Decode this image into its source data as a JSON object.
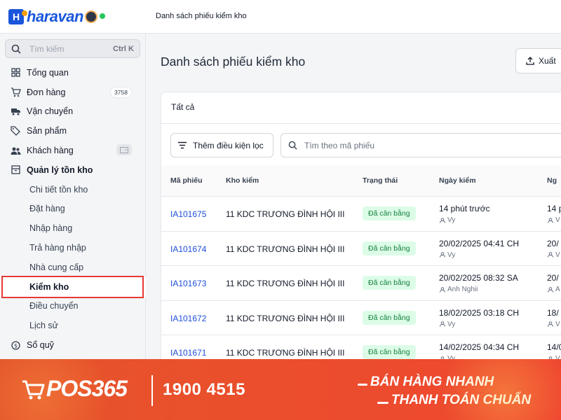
{
  "brand": {
    "logo_text": "haravan"
  },
  "header": {
    "breadcrumb": "Danh sách phiếu kiểm kho"
  },
  "sidebar": {
    "search_placeholder": "Tìm kiếm",
    "search_shortcut": "Ctrl K",
    "items": [
      {
        "label": "Tổng quan",
        "icon": "dashboard-icon"
      },
      {
        "label": "Đơn hàng",
        "icon": "cart-icon",
        "badge": "3758"
      },
      {
        "label": "Vận chuyển",
        "icon": "truck-icon"
      },
      {
        "label": "Sản phẩm",
        "icon": "tag-icon"
      },
      {
        "label": "Khách hàng",
        "icon": "users-icon"
      },
      {
        "label": "Quản lý tồn kho",
        "icon": "inventory-icon"
      }
    ],
    "sub_items": [
      {
        "label": "Chi tiết tồn kho"
      },
      {
        "label": "Đặt hàng"
      },
      {
        "label": "Nhập hàng"
      },
      {
        "label": "Trả hàng nhập"
      },
      {
        "label": "Nhà cung cấp"
      },
      {
        "label": "Kiểm kho",
        "active": true
      },
      {
        "label": "Điều chuyển"
      },
      {
        "label": "Lịch sử"
      }
    ],
    "partial_item": {
      "label": "Sổ quỹ"
    }
  },
  "main": {
    "title": "Danh sách phiếu kiểm kho",
    "export_label": "Xuất",
    "tab_all": "Tất cả",
    "filter_label": "Thêm điều kiện lọc",
    "search_placeholder": "Tìm theo mã phiếu",
    "columns": [
      "Mã phiếu",
      "Kho kiểm",
      "Trạng thái",
      "Ngày kiểm",
      "Ng"
    ],
    "rows": [
      {
        "code": "IA101675",
        "warehouse": "11 KDC TRƯƠNG ĐÌNH HỘI III",
        "status": "Đã cân bằng",
        "date": "14 phút trước",
        "user": "Vy",
        "date2": "14 p",
        "user2": "V"
      },
      {
        "code": "IA101674",
        "warehouse": "11 KDC TRƯƠNG ĐÌNH HỘI III",
        "status": "Đã cân bằng",
        "date": "20/02/2025 04:41 CH",
        "user": "Vy",
        "date2": "20/",
        "user2": "V"
      },
      {
        "code": "IA101673",
        "warehouse": "11 KDC TRƯƠNG ĐÌNH HỘI III",
        "status": "Đã cân bằng",
        "date": "20/02/2025 08:32 SA",
        "user": "Anh Nghii",
        "date2": "20/",
        "user2": "A"
      },
      {
        "code": "IA101672",
        "warehouse": "11 KDC TRƯƠNG ĐÌNH HỘI III",
        "status": "Đã cân bằng",
        "date": "18/02/2025 03:18 CH",
        "user": "Vy",
        "date2": "18/",
        "user2": "V"
      },
      {
        "code": "IA101671",
        "warehouse": "11 KDC TRƯƠNG ĐÌNH HỘI III",
        "status": "Đã cân bằng",
        "date": "14/02/2025 04:34 CH",
        "user": "Vy",
        "date2": "14/0",
        "user2": "V"
      }
    ]
  },
  "banner": {
    "logo_text": "POS365",
    "hotline": "1900 4515",
    "slogan_line1": "BÁN HÀNG NHANH",
    "slogan_line2": "THANH TOÁN CHUẨN"
  },
  "colors": {
    "brand_blue": "#1a56db",
    "status_green_bg": "#dcfce7",
    "status_green_text": "#15803d",
    "banner_orange": "#ea4f2c",
    "highlight_red": "#e53935"
  }
}
